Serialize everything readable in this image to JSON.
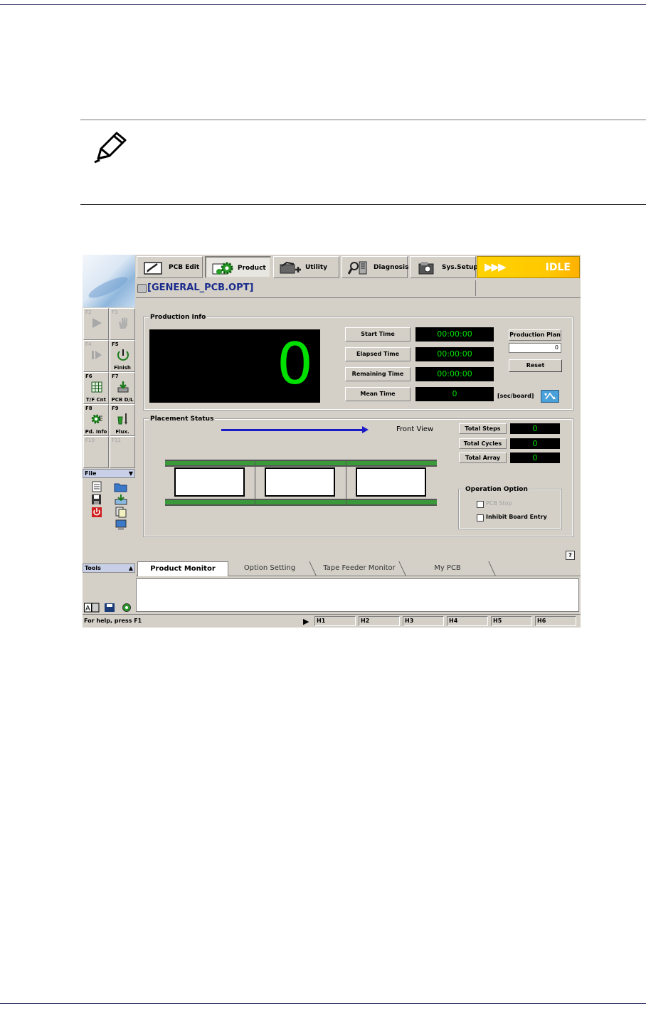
{
  "screen": {
    "top_tabs": [
      {
        "label": "PCB Edit",
        "icon": "pcb-edit-icon",
        "selected": false
      },
      {
        "label": "Product",
        "icon": "product-gear-icon",
        "selected": true
      },
      {
        "label": "Utility",
        "icon": "utility-icon",
        "selected": false
      },
      {
        "label": "Diagnosis",
        "icon": "diagnosis-icon",
        "selected": false
      },
      {
        "label": "Sys.Setup",
        "icon": "sys-setup-icon",
        "selected": false
      }
    ],
    "status_indicator": {
      "label": "IDLE",
      "arrows": "▶▶▶",
      "color": "#ffcc00"
    },
    "file_name": "[GENERAL_PCB.OPT]",
    "function_keys": [
      {
        "key": "F2",
        "label": "",
        "icon": "play-icon",
        "enabled": false
      },
      {
        "key": "F3",
        "label": "",
        "icon": "hand-stop-icon",
        "enabled": false
      },
      {
        "key": "F4",
        "label": "",
        "icon": "step-icon",
        "enabled": false
      },
      {
        "key": "F5",
        "label": "Finish",
        "icon": "finish-icon",
        "enabled": true
      },
      {
        "key": "F6",
        "label": "T/F Cnt",
        "icon": "grid-icon",
        "enabled": true
      },
      {
        "key": "F7",
        "label": "PCB D/L",
        "icon": "download-icon",
        "enabled": true
      },
      {
        "key": "F8",
        "label": "Pd. Info",
        "icon": "gear-icon",
        "enabled": true
      },
      {
        "key": "F9",
        "label": "Flux.",
        "icon": "flux-icon",
        "enabled": true
      },
      {
        "key": "F10",
        "label": "",
        "icon": "",
        "enabled": false
      },
      {
        "key": "F11",
        "label": "",
        "icon": "",
        "enabled": false
      }
    ],
    "file_panel": {
      "title": "File",
      "arrow": "▼"
    },
    "tools_panel": {
      "title": "Tools",
      "arrow": "▲"
    },
    "production_info": {
      "title": "Production Info",
      "count": "0",
      "rows": [
        {
          "label": "Start Time",
          "value": "00:00:00"
        },
        {
          "label": "Elapsed Time",
          "value": "00:00:00"
        },
        {
          "label": "Remaining Time",
          "value": "00:00:00"
        },
        {
          "label": "Mean Time",
          "value": "0"
        }
      ],
      "unit": "[sec/board]",
      "production_plan_label": "Production Plan",
      "production_plan_value": "0",
      "reset_label": "Reset"
    },
    "placement_status": {
      "title": "Placement Status",
      "view_label": "Front View",
      "counters": [
        {
          "label": "Total Steps",
          "value": "0"
        },
        {
          "label": "Total Cycles",
          "value": "0"
        },
        {
          "label": "Total Array",
          "value": "0"
        }
      ],
      "operation_option": {
        "title": "Operation Option",
        "options": [
          {
            "label": "PCB Stop",
            "checked": false,
            "enabled": false
          },
          {
            "label": "Inhibit Board Entry",
            "checked": false,
            "enabled": true
          }
        ]
      }
    },
    "help_button": "?",
    "bottom_tabs": [
      {
        "label": "Product Monitor",
        "selected": true
      },
      {
        "label": "Option Setting",
        "selected": false
      },
      {
        "label": "Tape Feeder Monitor",
        "selected": false
      },
      {
        "label": "My PCB",
        "selected": false
      }
    ],
    "status_bar": {
      "help_text": "For help, press F1",
      "play": "▶",
      "heads": [
        "H1",
        "H2",
        "H3",
        "H4",
        "H5",
        "H6"
      ]
    }
  }
}
